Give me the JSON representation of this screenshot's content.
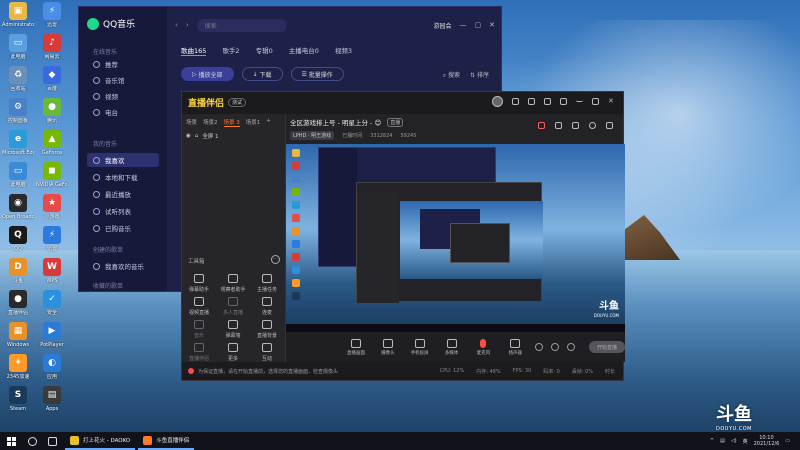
{
  "desktop": {
    "icons": [
      {
        "label": "Administrator",
        "color": "#e8b84a",
        "glyph": "▣"
      },
      {
        "label": "迅雷",
        "color": "#4a8ee8",
        "glyph": "⚡"
      },
      {
        "label": "此电脑",
        "color": "#5aa0e0",
        "glyph": "▭"
      },
      {
        "label": "网易云",
        "color": "#d83a3a",
        "glyph": "♪"
      },
      {
        "label": "回收站",
        "color": "#6a8fb8",
        "glyph": "♻"
      },
      {
        "label": "百度",
        "color": "#3a6ae0",
        "glyph": "◆"
      },
      {
        "label": "控制面板",
        "color": "#4a80c8",
        "glyph": "⚙"
      },
      {
        "label": "腾讯",
        "color": "#6ab83a",
        "glyph": "●"
      },
      {
        "label": "Microsoft Edge",
        "color": "#2a9ad8",
        "glyph": "e"
      },
      {
        "label": "GeForce",
        "color": "#76b900",
        "glyph": "▲"
      },
      {
        "label": "此电脑",
        "color": "#3a8ad8",
        "glyph": "▭"
      },
      {
        "label": "NVIDIA GeForce Experience",
        "color": "#76b900",
        "glyph": "◼"
      },
      {
        "label": "Open Broadcaster",
        "color": "#2a2a2a",
        "glyph": "◉"
      },
      {
        "label": "小游戏",
        "color": "#e84a4a",
        "glyph": "★"
      },
      {
        "label": "QQ",
        "color": "#1a1a1a",
        "glyph": "Q"
      },
      {
        "label": "迅雷",
        "color": "#2a7ae0",
        "glyph": "⚡"
      },
      {
        "label": "斗鱼",
        "color": "#e8902a",
        "glyph": "D"
      },
      {
        "label": "WPS",
        "color": "#d83a3a",
        "glyph": "W"
      },
      {
        "label": "直播伴侣",
        "color": "#2a2a2a",
        "glyph": "●"
      },
      {
        "label": "安全",
        "color": "#2a90e0",
        "glyph": "✓"
      },
      {
        "label": "Windows",
        "color": "#e8902a",
        "glyph": "▦"
      },
      {
        "label": "PotPlayer",
        "color": "#2a7ad8",
        "glyph": "▶"
      },
      {
        "label": "2345加速",
        "color": "#ff9a2a",
        "glyph": "✦"
      },
      {
        "label": "应用",
        "color": "#2a7ad8",
        "glyph": "◐"
      },
      {
        "label": "Steam",
        "color": "#1a3a5a",
        "glyph": "S"
      },
      {
        "label": "Apps",
        "color": "#3a3a3a",
        "glyph": "▤"
      }
    ]
  },
  "qqmusic": {
    "app_name": "QQ音乐",
    "search_placeholder": "搜索",
    "user": "游园会",
    "section_online": "在线音乐",
    "nav": [
      {
        "label": "推荐",
        "active": false
      },
      {
        "label": "音乐馆",
        "active": false
      },
      {
        "label": "视频",
        "active": false
      },
      {
        "label": "电台",
        "active": false
      }
    ],
    "section_mine": "我的音乐",
    "mine": [
      {
        "label": "我喜欢",
        "active": true
      },
      {
        "label": "本地和下载",
        "active": false
      },
      {
        "label": "最近播放",
        "active": false
      },
      {
        "label": "试听列表",
        "active": false
      },
      {
        "label": "已购音乐",
        "active": false
      }
    ],
    "section_created": "创建的歌单",
    "created_item": "我喜欢的音乐",
    "section_collect": "收藏的歌单",
    "tabs": [
      {
        "label": "歌曲165",
        "on": true
      },
      {
        "label": "歌手2",
        "on": false
      },
      {
        "label": "专辑0",
        "on": false
      },
      {
        "label": "主播电台0",
        "on": false
      },
      {
        "label": "视频3",
        "on": false
      }
    ],
    "play_all": "播放全部",
    "download": "下载",
    "batch": "批量操作",
    "search_label": "搜索",
    "sort_label": "排序"
  },
  "streamer": {
    "app_name": "直播伴侣",
    "badge": "测试",
    "scene_tabs": [
      {
        "label": "场景",
        "on": false
      },
      {
        "label": "场景2",
        "on": false
      },
      {
        "label": "场景 3",
        "on": true
      },
      {
        "label": "场景1",
        "on": false
      }
    ],
    "scene_row": "全屏 1",
    "tools_title": "工具箱",
    "tools": [
      {
        "label": "弹幕助手",
        "dim": false
      },
      {
        "label": "观察者助手",
        "dim": false
      },
      {
        "label": "主播任务",
        "dim": false
      },
      {
        "label": "视频直播",
        "dim": false
      },
      {
        "label": "多人直播",
        "dim": true
      },
      {
        "label": "连麦",
        "dim": false
      },
      {
        "label": "音乐",
        "dim": true
      },
      {
        "label": "弹幕墙",
        "dim": false
      },
      {
        "label": "直播背景",
        "dim": false
      },
      {
        "label": "直播伴侣",
        "dim": true
      },
      {
        "label": "更多",
        "dim": false
      },
      {
        "label": "互动",
        "dim": false
      }
    ],
    "room_title": "全区游戏排上号 - 明星上分 - 😊",
    "room_tag": "直播",
    "meta": {
      "category": "LPHD · 明王游戏",
      "time": "已播时间",
      "id": "3312824",
      "fans": "59245"
    },
    "bottom_tools": [
      {
        "label": "直播画面"
      },
      {
        "label": "摄像头"
      },
      {
        "label": "手机投屏"
      },
      {
        "label": "多媒体"
      },
      {
        "label": "麦克风",
        "mic": true
      },
      {
        "label": "扬声器"
      }
    ],
    "start_label": "开始直播",
    "status_text": "为保证直播，请在开始直播前，选择您的直播画面，检查摄像头",
    "stats": [
      "CPU: 12%",
      "内存: 48%",
      "FPS: 30",
      "码率: 0",
      "丢帧: 0%",
      "时长"
    ]
  },
  "preview_watermark": {
    "logo": "斗鱼",
    "domain": "DOUYU.COM"
  },
  "watermark": {
    "logo": "斗鱼",
    "domain": "DOUYU.COM"
  },
  "taskbar": {
    "apps": [
      {
        "label": "打上花火 - DAOKO",
        "color": "#e8c02a"
      },
      {
        "label": "斗鱼直播伴侣",
        "color": "#ff7a2a"
      }
    ],
    "tray_lang": "英",
    "time": "10:10",
    "date": "2021/12/6"
  }
}
